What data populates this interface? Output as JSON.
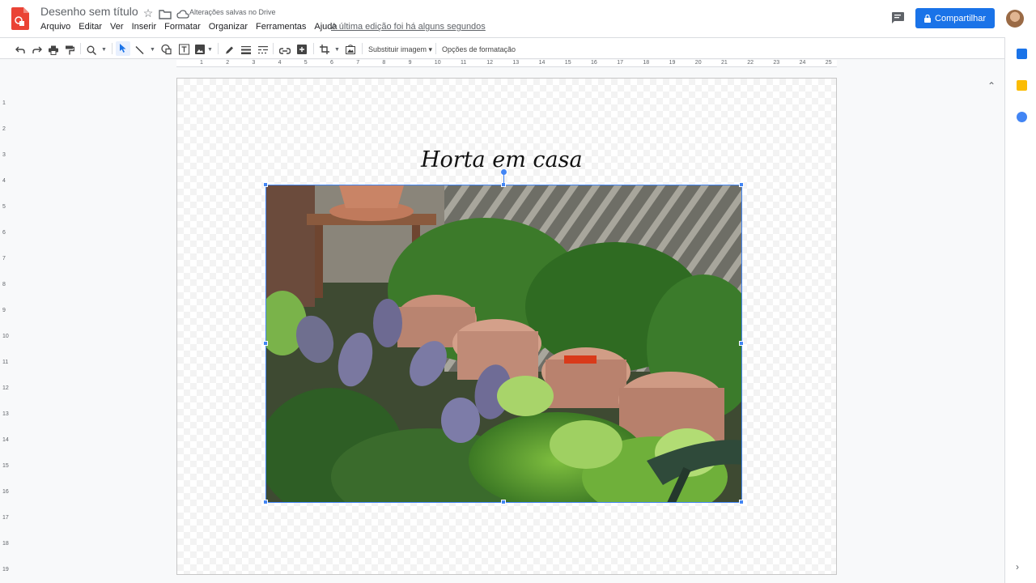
{
  "header": {
    "doc_title": "Desenho sem título",
    "saved_status": "Alterações salvas no Drive",
    "last_edit": "A última edição foi há alguns segundos",
    "share_label": "Compartilhar",
    "menu": [
      "Arquivo",
      "Editar",
      "Ver",
      "Inserir",
      "Formatar",
      "Organizar",
      "Ferramentas",
      "Ajuda"
    ]
  },
  "toolbar": {
    "replace_image": "Substituir imagem",
    "format_options": "Opções de formatação"
  },
  "ruler": {
    "horizontal": [
      "1",
      "2",
      "3",
      "4",
      "5",
      "6",
      "7",
      "8",
      "9",
      "10",
      "11",
      "12",
      "13",
      "14",
      "15",
      "16",
      "17",
      "18",
      "19",
      "20",
      "21",
      "22",
      "23",
      "24",
      "25"
    ],
    "vertical": [
      "1",
      "2",
      "3",
      "4",
      "5",
      "6",
      "7",
      "8",
      "9",
      "10",
      "11",
      "12",
      "13",
      "14",
      "15",
      "16",
      "17",
      "18",
      "19"
    ]
  },
  "canvas": {
    "title_text": "Horta em casa"
  },
  "colors": {
    "accent": "#1a73e8",
    "selection": "#4285f4",
    "docs_red": "#ea4335"
  },
  "icons": [
    "undo-icon",
    "redo-icon",
    "print-icon",
    "paint-format-icon",
    "zoom-icon",
    "select-icon",
    "line-icon",
    "shape-icon",
    "textbox-icon",
    "image-icon",
    "pen-icon",
    "line-weight-icon",
    "line-dash-icon",
    "link-icon",
    "comment-add-icon",
    "crop-icon",
    "reset-image-icon",
    "comment-icon",
    "lock-icon",
    "star-icon",
    "folder-icon",
    "cloud-icon"
  ]
}
